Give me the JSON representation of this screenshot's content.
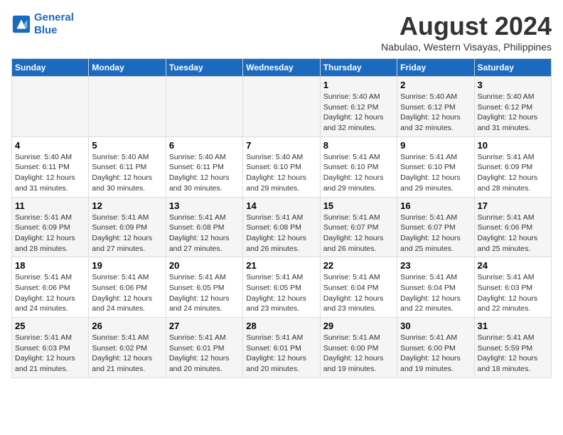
{
  "header": {
    "logo_line1": "General",
    "logo_line2": "Blue",
    "title": "August 2024",
    "subtitle": "Nabulao, Western Visayas, Philippines"
  },
  "days_of_week": [
    "Sunday",
    "Monday",
    "Tuesday",
    "Wednesday",
    "Thursday",
    "Friday",
    "Saturday"
  ],
  "weeks": [
    [
      {
        "day": "",
        "info": ""
      },
      {
        "day": "",
        "info": ""
      },
      {
        "day": "",
        "info": ""
      },
      {
        "day": "",
        "info": ""
      },
      {
        "day": "1",
        "info": "Sunrise: 5:40 AM\nSunset: 6:12 PM\nDaylight: 12 hours\nand 32 minutes."
      },
      {
        "day": "2",
        "info": "Sunrise: 5:40 AM\nSunset: 6:12 PM\nDaylight: 12 hours\nand 32 minutes."
      },
      {
        "day": "3",
        "info": "Sunrise: 5:40 AM\nSunset: 6:12 PM\nDaylight: 12 hours\nand 31 minutes."
      }
    ],
    [
      {
        "day": "4",
        "info": "Sunrise: 5:40 AM\nSunset: 6:11 PM\nDaylight: 12 hours\nand 31 minutes."
      },
      {
        "day": "5",
        "info": "Sunrise: 5:40 AM\nSunset: 6:11 PM\nDaylight: 12 hours\nand 30 minutes."
      },
      {
        "day": "6",
        "info": "Sunrise: 5:40 AM\nSunset: 6:11 PM\nDaylight: 12 hours\nand 30 minutes."
      },
      {
        "day": "7",
        "info": "Sunrise: 5:40 AM\nSunset: 6:10 PM\nDaylight: 12 hours\nand 29 minutes."
      },
      {
        "day": "8",
        "info": "Sunrise: 5:41 AM\nSunset: 6:10 PM\nDaylight: 12 hours\nand 29 minutes."
      },
      {
        "day": "9",
        "info": "Sunrise: 5:41 AM\nSunset: 6:10 PM\nDaylight: 12 hours\nand 29 minutes."
      },
      {
        "day": "10",
        "info": "Sunrise: 5:41 AM\nSunset: 6:09 PM\nDaylight: 12 hours\nand 28 minutes."
      }
    ],
    [
      {
        "day": "11",
        "info": "Sunrise: 5:41 AM\nSunset: 6:09 PM\nDaylight: 12 hours\nand 28 minutes."
      },
      {
        "day": "12",
        "info": "Sunrise: 5:41 AM\nSunset: 6:09 PM\nDaylight: 12 hours\nand 27 minutes."
      },
      {
        "day": "13",
        "info": "Sunrise: 5:41 AM\nSunset: 6:08 PM\nDaylight: 12 hours\nand 27 minutes."
      },
      {
        "day": "14",
        "info": "Sunrise: 5:41 AM\nSunset: 6:08 PM\nDaylight: 12 hours\nand 26 minutes."
      },
      {
        "day": "15",
        "info": "Sunrise: 5:41 AM\nSunset: 6:07 PM\nDaylight: 12 hours\nand 26 minutes."
      },
      {
        "day": "16",
        "info": "Sunrise: 5:41 AM\nSunset: 6:07 PM\nDaylight: 12 hours\nand 25 minutes."
      },
      {
        "day": "17",
        "info": "Sunrise: 5:41 AM\nSunset: 6:06 PM\nDaylight: 12 hours\nand 25 minutes."
      }
    ],
    [
      {
        "day": "18",
        "info": "Sunrise: 5:41 AM\nSunset: 6:06 PM\nDaylight: 12 hours\nand 24 minutes."
      },
      {
        "day": "19",
        "info": "Sunrise: 5:41 AM\nSunset: 6:06 PM\nDaylight: 12 hours\nand 24 minutes."
      },
      {
        "day": "20",
        "info": "Sunrise: 5:41 AM\nSunset: 6:05 PM\nDaylight: 12 hours\nand 24 minutes."
      },
      {
        "day": "21",
        "info": "Sunrise: 5:41 AM\nSunset: 6:05 PM\nDaylight: 12 hours\nand 23 minutes."
      },
      {
        "day": "22",
        "info": "Sunrise: 5:41 AM\nSunset: 6:04 PM\nDaylight: 12 hours\nand 23 minutes."
      },
      {
        "day": "23",
        "info": "Sunrise: 5:41 AM\nSunset: 6:04 PM\nDaylight: 12 hours\nand 22 minutes."
      },
      {
        "day": "24",
        "info": "Sunrise: 5:41 AM\nSunset: 6:03 PM\nDaylight: 12 hours\nand 22 minutes."
      }
    ],
    [
      {
        "day": "25",
        "info": "Sunrise: 5:41 AM\nSunset: 6:03 PM\nDaylight: 12 hours\nand 21 minutes."
      },
      {
        "day": "26",
        "info": "Sunrise: 5:41 AM\nSunset: 6:02 PM\nDaylight: 12 hours\nand 21 minutes."
      },
      {
        "day": "27",
        "info": "Sunrise: 5:41 AM\nSunset: 6:01 PM\nDaylight: 12 hours\nand 20 minutes."
      },
      {
        "day": "28",
        "info": "Sunrise: 5:41 AM\nSunset: 6:01 PM\nDaylight: 12 hours\nand 20 minutes."
      },
      {
        "day": "29",
        "info": "Sunrise: 5:41 AM\nSunset: 6:00 PM\nDaylight: 12 hours\nand 19 minutes."
      },
      {
        "day": "30",
        "info": "Sunrise: 5:41 AM\nSunset: 6:00 PM\nDaylight: 12 hours\nand 19 minutes."
      },
      {
        "day": "31",
        "info": "Sunrise: 5:41 AM\nSunset: 5:59 PM\nDaylight: 12 hours\nand 18 minutes."
      }
    ]
  ]
}
